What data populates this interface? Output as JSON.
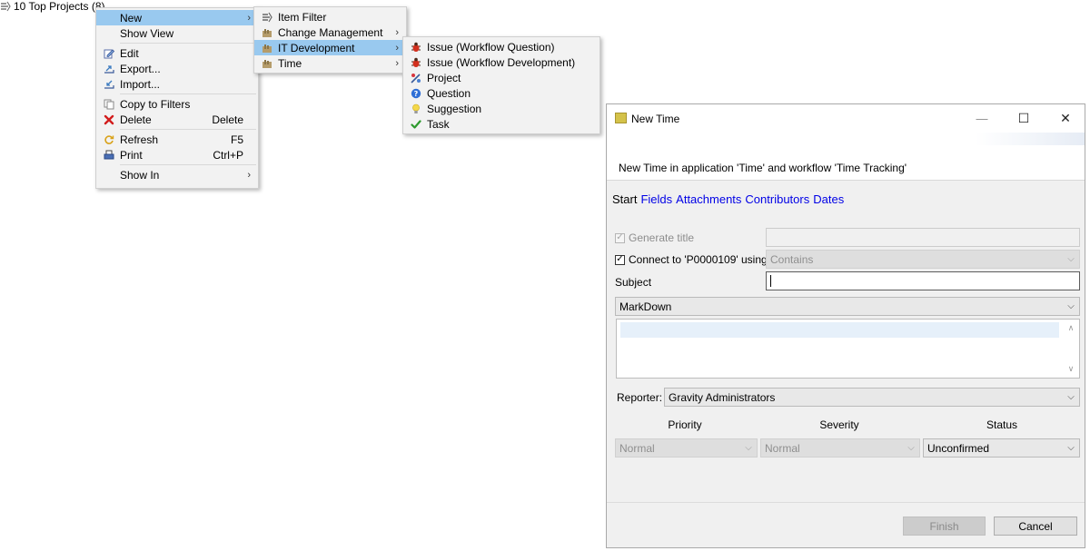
{
  "tree": {
    "node_label": "10 Top Projects (8)"
  },
  "context_menu": {
    "items": [
      {
        "label": "New",
        "shortcut": "",
        "icon": "none"
      },
      {
        "label": "Show View",
        "shortcut": "",
        "icon": "none"
      },
      {
        "label": "Edit",
        "shortcut": "",
        "icon": "edit-icon"
      },
      {
        "label": "Export...",
        "shortcut": "",
        "icon": "export-icon"
      },
      {
        "label": "Import...",
        "shortcut": "",
        "icon": "import-icon"
      },
      {
        "label": "Copy to Filters",
        "shortcut": "",
        "icon": "copy-icon"
      },
      {
        "label": "Delete",
        "shortcut": "Delete",
        "icon": "delete-icon"
      },
      {
        "label": "Refresh",
        "shortcut": "F5",
        "icon": "refresh-icon"
      },
      {
        "label": "Print",
        "shortcut": "Ctrl+P",
        "icon": "print-icon"
      },
      {
        "label": "Show In",
        "shortcut": "",
        "icon": "none"
      }
    ]
  },
  "new_submenu": {
    "items": [
      {
        "label": "Item Filter",
        "icon": "filter-icon"
      },
      {
        "label": "Change Management",
        "icon": "folder-icon"
      },
      {
        "label": "IT Development",
        "icon": "folder-icon"
      },
      {
        "label": "Time",
        "icon": "folder-icon"
      }
    ]
  },
  "it_dev_submenu": {
    "items": [
      {
        "label": "Issue (Workflow Question)",
        "icon": "bug-icon"
      },
      {
        "label": "Issue (Workflow Development)",
        "icon": "bug-icon"
      },
      {
        "label": "Project",
        "icon": "project-icon"
      },
      {
        "label": "Question",
        "icon": "question-icon"
      },
      {
        "label": "Suggestion",
        "icon": "lightbulb-icon"
      },
      {
        "label": "Task",
        "icon": "check-icon"
      }
    ]
  },
  "dialog": {
    "title": "New Time",
    "header_text": "New Time in application 'Time' and workflow 'Time Tracking'",
    "tabs": [
      "Start",
      "Fields",
      "Attachments",
      "Contributors",
      "Dates"
    ],
    "generate_title_label": "Generate title",
    "generate_title_value": "",
    "connect_label": "Connect to 'P0000109' using:",
    "connect_mode": "Contains",
    "subject_label": "Subject",
    "subject_value": "",
    "format_value": "MarkDown",
    "reporter_label": "Reporter:",
    "reporter_value": "Gravity Administrators",
    "priority_label": "Priority",
    "priority_value": "Normal",
    "severity_label": "Severity",
    "severity_value": "Normal",
    "status_label": "Status",
    "status_value": "Unconfirmed",
    "finish_label": "Finish",
    "cancel_label": "Cancel",
    "minimize_glyph": "—",
    "maximize_glyph": "☐",
    "close_glyph": "✕"
  },
  "colors": {
    "selection": "#99c9ef",
    "link": "#0000e6",
    "menu_bg": "#f2f2f2"
  }
}
